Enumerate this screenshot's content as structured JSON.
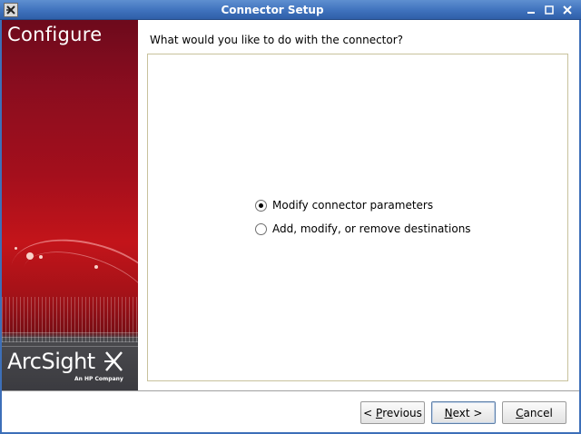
{
  "window": {
    "title": "Connector Setup",
    "icons": {
      "app": "arcsight-x-icon",
      "minimize": "minimize-icon",
      "maximize": "maximize-icon",
      "close": "close-icon"
    }
  },
  "banner": {
    "title": "Configure",
    "logo_text": "ArcSight",
    "logo_subtext": "An HP Company"
  },
  "main": {
    "question": "What would you like to do with the connector?",
    "options": [
      {
        "label": "Modify connector parameters",
        "selected": true
      },
      {
        "label": "Add, modify, or remove destinations",
        "selected": false
      }
    ]
  },
  "buttons": {
    "previous": {
      "prefix": "< ",
      "mnemonic": "P",
      "rest": "revious"
    },
    "next": {
      "mnemonic": "N",
      "rest": "ext >"
    },
    "cancel": {
      "mnemonic": "C",
      "rest": "ancel"
    }
  },
  "colors": {
    "titlebar": "#3f72bd",
    "banner_red": "#c3141a",
    "panel_border": "#c8c29c"
  }
}
